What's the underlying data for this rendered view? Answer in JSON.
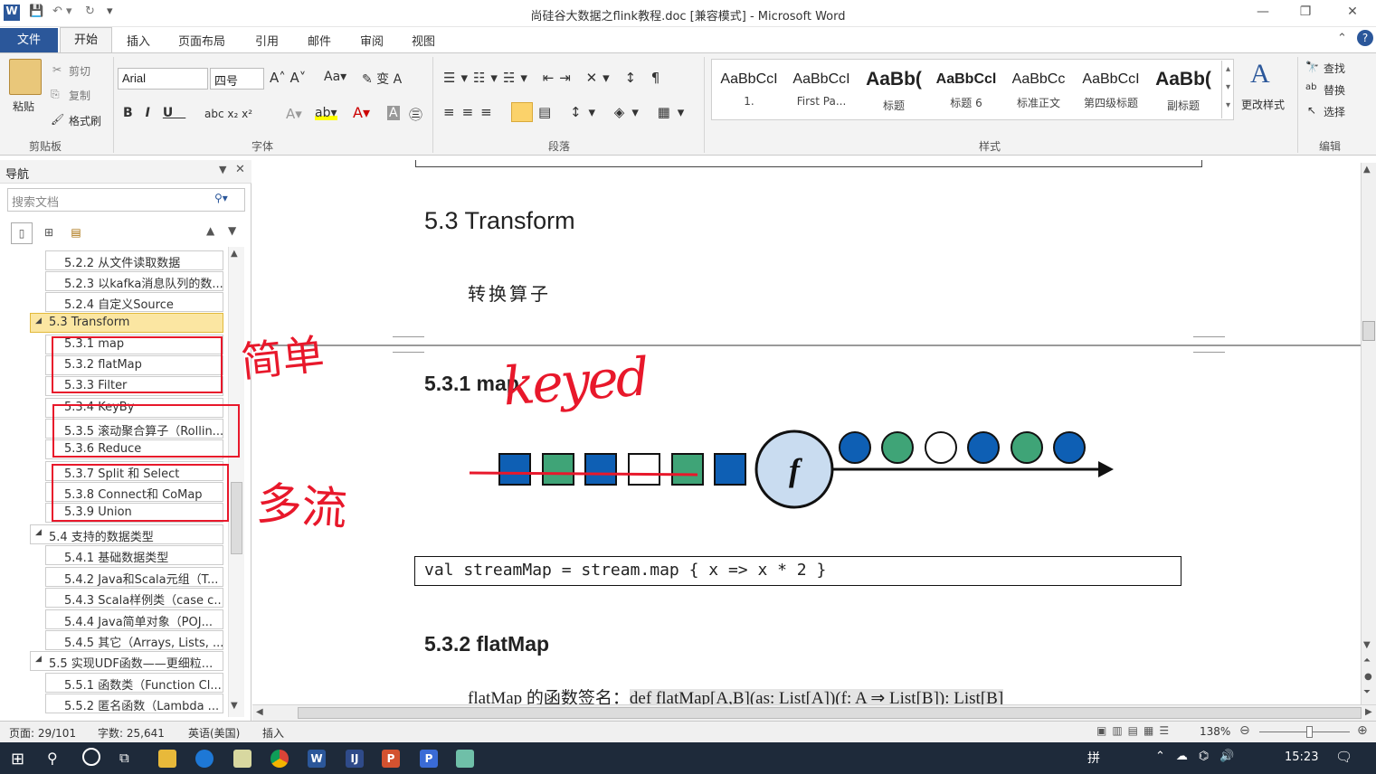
{
  "window": {
    "title": "尚硅谷大数据之flink教程.doc [兼容模式] - Microsoft Word"
  },
  "tabs": [
    "文件",
    "开始",
    "插入",
    "页面布局",
    "引用",
    "邮件",
    "审阅",
    "视图"
  ],
  "clipboard": {
    "paste": "粘贴",
    "cut": "剪切",
    "copy": "复制",
    "format_painter": "格式刷",
    "label": "剪贴板"
  },
  "font": {
    "name": "Arial",
    "size": "四号",
    "label": "字体"
  },
  "paragraph": {
    "label": "段落"
  },
  "styles": {
    "label": "样式",
    "items": [
      {
        "preview": "AaBbCcI",
        "name": "1."
      },
      {
        "preview": "AaBbCcI",
        "name": "First Pa..."
      },
      {
        "preview": "AaBb(",
        "name": "标题"
      },
      {
        "preview": "AaBbCcl",
        "name": "标题 6"
      },
      {
        "preview": "AaBbCc",
        "name": "标准正文"
      },
      {
        "preview": "AaBbCcI",
        "name": "第四级标题"
      },
      {
        "preview": "AaBb(",
        "name": "副标题"
      }
    ],
    "change": "更改样式"
  },
  "editing": {
    "find": "查找",
    "replace": "替换",
    "select": "选择",
    "label": "编辑"
  },
  "nav": {
    "title": "导航",
    "search_placeholder": "搜索文档",
    "items": [
      "5.2.2 从文件读取数据",
      "5.2.3 以kafka消息队列的数...",
      "5.2.4 自定义Source",
      "5.3 Transform",
      "5.3.1 map",
      "5.3.2 flatMap",
      "5.3.3 Filter",
      "5.3.4 KeyBy",
      "5.3.5 滚动聚合算子（Rollin...",
      "5.3.6 Reduce",
      "5.3.7 Split 和 Select",
      "5.3.8 Connect和 CoMap",
      "5.3.9 Union",
      "5.4 支持的数据类型",
      "5.4.1 基础数据类型",
      "5.4.2 Java和Scala元组（T...",
      "5.4.3 Scala样例类（case c...",
      "5.4.4 Java简单对象（POJ...",
      "5.4.5 其它（Arrays, Lists, ...",
      "5.5 实现UDF函数——更细粒...",
      "5.5.1 函数类（Function Cl...",
      "5.5.2 匿名函数（Lambda ..."
    ]
  },
  "doc": {
    "h_transform": "5.3 Transform",
    "transform_desc": "转换算子",
    "h_map": "5.3.1 map",
    "code_map": "val streamMap = stream.map { x => x * 2 }",
    "h_flatmap": "5.3.2 flatMap",
    "flatmap_sig_label": "flatMap 的函数签名：",
    "flatmap_sig": "def flatMap[A,B](as: List[A])(f: A ⇒ List[B]): List[B]",
    "fn_symbol": "f"
  },
  "handwriting": {
    "keyed": "keyed",
    "simple": "简单",
    "multi": "多流"
  },
  "status": {
    "page": "页面: 29/101",
    "words": "字数: 25,641",
    "lang": "英语(美国)",
    "mode": "插入",
    "zoom": "138%"
  },
  "taskbar": {
    "time": "15:23",
    "ime": "拼"
  },
  "colors": {
    "accent": "#2b579a",
    "blue": "#0e5fb4",
    "green": "#3fa477",
    "highlight": "#e8182b"
  }
}
